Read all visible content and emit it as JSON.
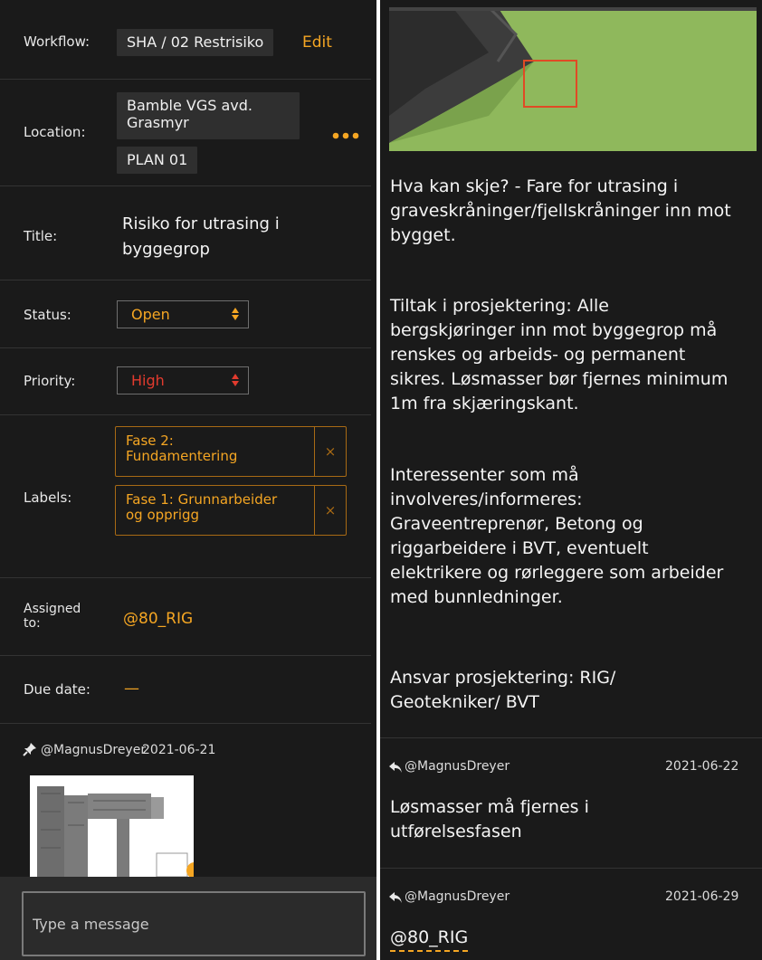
{
  "details": {
    "workflow": {
      "label": "Workflow:",
      "value": "SHA / 02 Restrisiko",
      "edit": "Edit"
    },
    "location": {
      "label": "Location:",
      "line1": "Bamble VGS avd.",
      "line2": "Grasmyr",
      "plan": "PLAN 01",
      "more_icon": "more-icon"
    },
    "title": {
      "label": "Title:",
      "line1": "Risiko for utrasing i",
      "line2": "byggegrop"
    },
    "status": {
      "label": "Status:",
      "value": "Open",
      "color": "#f5a623"
    },
    "priority": {
      "label": "Priority:",
      "value": "High",
      "color": "#e23b2e"
    },
    "labels": {
      "label": "Labels:",
      "items": [
        {
          "line1": "Fase 2:",
          "line2": "Fundamentering"
        },
        {
          "line1": "Fase 1: Grunnarbeider",
          "line2": "og opprigg"
        }
      ],
      "remove_icon": "×"
    },
    "assigned": {
      "label_line1": "Assigned",
      "label_line2": "to:",
      "value": "@80_RIG"
    },
    "due": {
      "label": "Due date:",
      "value": "—"
    }
  },
  "first_comment": {
    "author": "@MagnusDreyer",
    "date": "2021-06-21",
    "icon": "pin-icon"
  },
  "composer": {
    "placeholder": "Type a message"
  },
  "description": {
    "lines_1": [
      "Hva kan skje? - Fare for utrasing i",
      "graveskråninger/fjellskråninger inn mot",
      "bygget."
    ],
    "lines_2": [
      "Tiltak i prosjektering: Alle",
      "bergskjøringer inn mot byggegrop må",
      "renskes og arbeids- og permanent",
      "sikres. Løsmasser bør fjernes minimum",
      "1m fra skjæringskant."
    ],
    "lines_3": [
      "Interessenter som må",
      "involveres/informeres:",
      "Graveentreprenør, Betong og",
      "riggarbeidere i BVT, eventuelt",
      "elektrikere og rørleggere som arbeider",
      "med bunnledninger."
    ],
    "lines_4": [
      "Ansvar prosjektering: RIG/",
      "Geotekniker/ BVT"
    ]
  },
  "replies": [
    {
      "author": "@MagnusDreyer",
      "date": "2021-06-22",
      "line1": "Løsmasser må fjernes i",
      "line2": "utførelsesfasen",
      "icon": "reply-icon"
    },
    {
      "author": "@MagnusDreyer",
      "date": "2021-06-29",
      "line1": "@80_RIG",
      "icon": "reply-icon"
    }
  ],
  "colors": {
    "accent": "#f5a623",
    "background": "#1a1a1a",
    "marker": "#e04a25",
    "terrain": "#8fb85c"
  }
}
